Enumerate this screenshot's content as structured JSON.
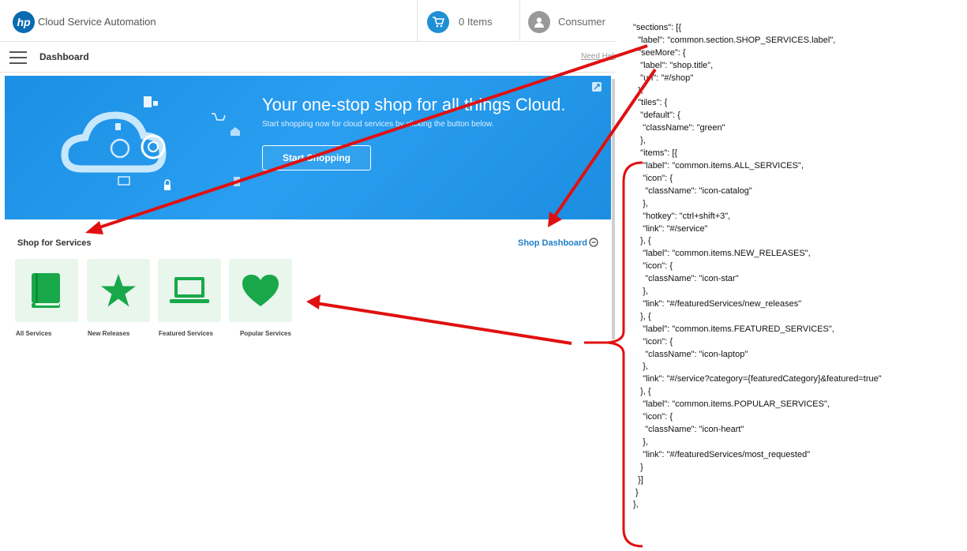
{
  "header": {
    "logo_text": "hp",
    "app_title": "Cloud Service Automation",
    "cart_label": "0 Items",
    "user_label": "Consumer"
  },
  "subheader": {
    "title": "Dashboard",
    "help_link": "Need Help"
  },
  "banner": {
    "title": "Your one-stop shop for all things Cloud.",
    "subtitle": "Start shopping now for cloud services by clicking the button below.",
    "button_label": "Start Shopping"
  },
  "shop_section": {
    "title": "Shop for Services",
    "see_more": "Shop Dashboard",
    "tiles": [
      {
        "label": "All Services",
        "icon": "book-icon"
      },
      {
        "label": "New Releases",
        "icon": "star-icon"
      },
      {
        "label": "Featured Services",
        "icon": "laptop-icon"
      },
      {
        "label": "Popular Services",
        "icon": "heart-icon"
      }
    ]
  },
  "code_lines": [
    "\"sections\": [{",
    "  \"label\": \"common.section.SHOP_SERVICES.label\",",
    "  \"seeMore\": {",
    "   \"label\": \"shop.title\",",
    "   \"url\": \"#/shop\"",
    "  },",
    "  \"tiles\": {",
    "   \"default\": {",
    "    \"className\": \"green\"",
    "   },",
    "   \"items\": [{",
    "    \"label\": \"common.items.ALL_SERVICES\",",
    "    \"icon\": {",
    "     \"className\": \"icon-catalog\"",
    "    },",
    "    \"hotkey\": \"ctrl+shift+3\",",
    "    \"link\": \"#/service\"",
    "   }, {",
    "    \"label\": \"common.items.NEW_RELEASES\",",
    "    \"icon\": {",
    "     \"className\": \"icon-star\"",
    "    },",
    "    \"link\": \"#/featuredServices/new_releases\"",
    "   }, {",
    "    \"label\": \"common.items.FEATURED_SERVICES\",",
    "    \"icon\": {",
    "     \"className\": \"icon-laptop\"",
    "    },",
    "    \"link\": \"#/service?category={featuredCategory}&featured=true\"",
    "   }, {",
    "    \"label\": \"common.items.POPULAR_SERVICES\",",
    "    \"icon\": {",
    "     \"className\": \"icon-heart\"",
    "    },",
    "    \"link\": \"#/featuredServices/most_requested\"",
    "   }",
    "  }]",
    " }",
    "},"
  ],
  "colors": {
    "brand_blue": "#1f8fd6",
    "tile_green": "#18a84a",
    "tile_bg": "#e9f6ec",
    "arrow_red": "#e01010"
  }
}
